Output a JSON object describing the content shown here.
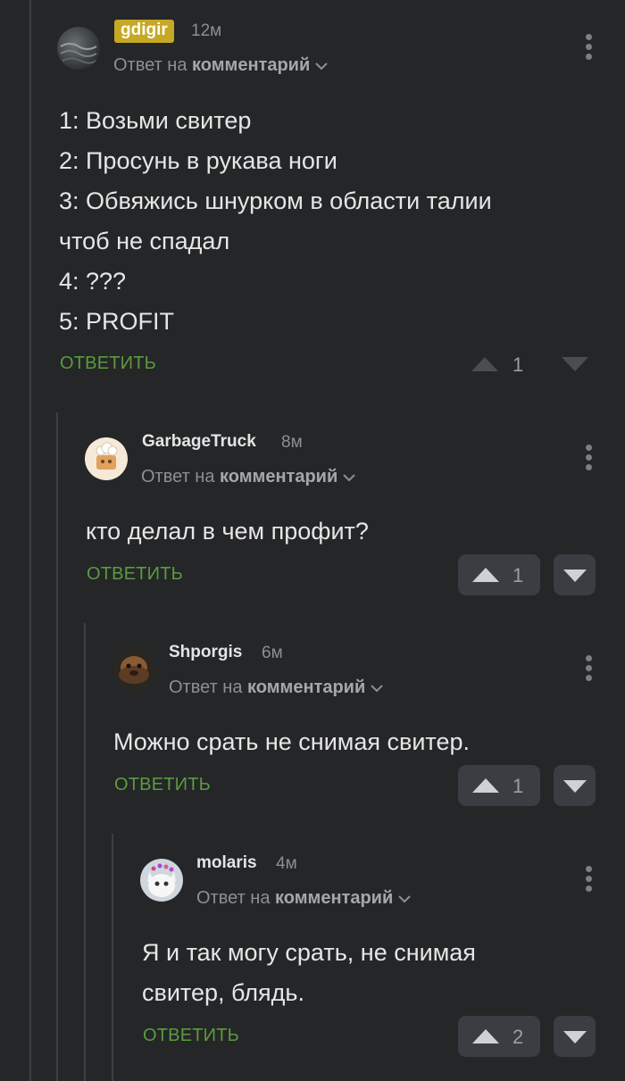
{
  "comments": [
    {
      "username": "gdigir",
      "time": "12м",
      "reply_prefix": "Ответ на",
      "reply_target": "комментарий",
      "lines": [
        "1: Возьми свитер",
        "2: Просунь в рукава ноги",
        "3: Обвяжись шнурком в области талии",
        "чтоб не спадал",
        "4: ???",
        "5: PROFIT"
      ],
      "reply_label": "ОТВЕТИТЬ",
      "votes": "1"
    },
    {
      "username": "GarbageTruck",
      "time": "8м",
      "reply_prefix": "Ответ на",
      "reply_target": "комментарий",
      "lines": [
        "кто делал в чем профит?"
      ],
      "reply_label": "ОТВЕТИТЬ",
      "votes": "1"
    },
    {
      "username": "Shporgis",
      "time": "6м",
      "reply_prefix": "Ответ на",
      "reply_target": "комментарий",
      "lines": [
        "Можно срать не снимая свитер."
      ],
      "reply_label": "ОТВЕТИТЬ",
      "votes": "1"
    },
    {
      "username": "molaris",
      "time": "4м",
      "reply_prefix": "Ответ на",
      "reply_target": "комментарий",
      "lines": [
        "Я и так могу срать, не снимая",
        "свитер, блядь."
      ],
      "reply_label": "ОТВЕТИТЬ",
      "votes": "2"
    }
  ],
  "colors": {
    "background": "#242628",
    "reply_button": "#5c9a3e",
    "username_badge": "#c5a823",
    "vote_box": "#3a3d41"
  },
  "icons": [
    "more-vertical-icon",
    "chevron-down-icon",
    "upvote-arrow-icon",
    "downvote-arrow-icon"
  ]
}
